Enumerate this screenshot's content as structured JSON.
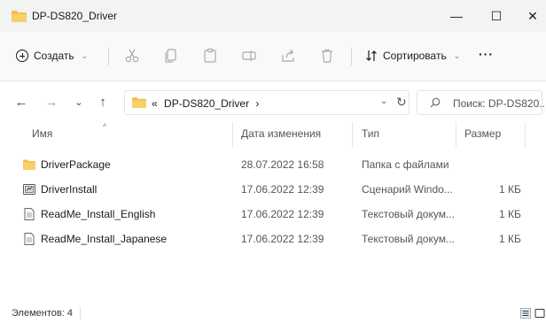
{
  "window": {
    "title": "DP-DS820_Driver",
    "minimize": "—",
    "maximize": "☐",
    "close": "✕"
  },
  "toolbar": {
    "new_label": "Создать",
    "sort_label": "Сортировать",
    "more": "···",
    "dropdown": "⌄"
  },
  "address": {
    "prefix": "«",
    "path": "DP-DS820_Driver",
    "sep": "›",
    "search_placeholder": "Поиск: DP-DS820..."
  },
  "columns": {
    "name": "Имя",
    "date": "Дата изменения",
    "type": "Тип",
    "size": "Размер"
  },
  "files": [
    {
      "name": "DriverPackage",
      "date": "28.07.2022 16:58",
      "type": "Папка с файлами",
      "size": "",
      "icon": "folder-icon"
    },
    {
      "name": "DriverInstall",
      "date": "17.06.2022 12:39",
      "type": "Сценарий Windo...",
      "size": "1 КБ",
      "icon": "script-file-icon"
    },
    {
      "name": "ReadMe_Install_English",
      "date": "17.06.2022 12:39",
      "type": "Текстовый докум...",
      "size": "1 КБ",
      "icon": "text-file-icon"
    },
    {
      "name": "ReadMe_Install_Japanese",
      "date": "17.06.2022 12:39",
      "type": "Текстовый докум...",
      "size": "1 КБ",
      "icon": "text-file-icon"
    }
  ],
  "status": {
    "count_text": "Элементов: 4"
  },
  "colors": {
    "folder": "#f2c14e",
    "titlebar_bg": "#f3f3f3"
  }
}
